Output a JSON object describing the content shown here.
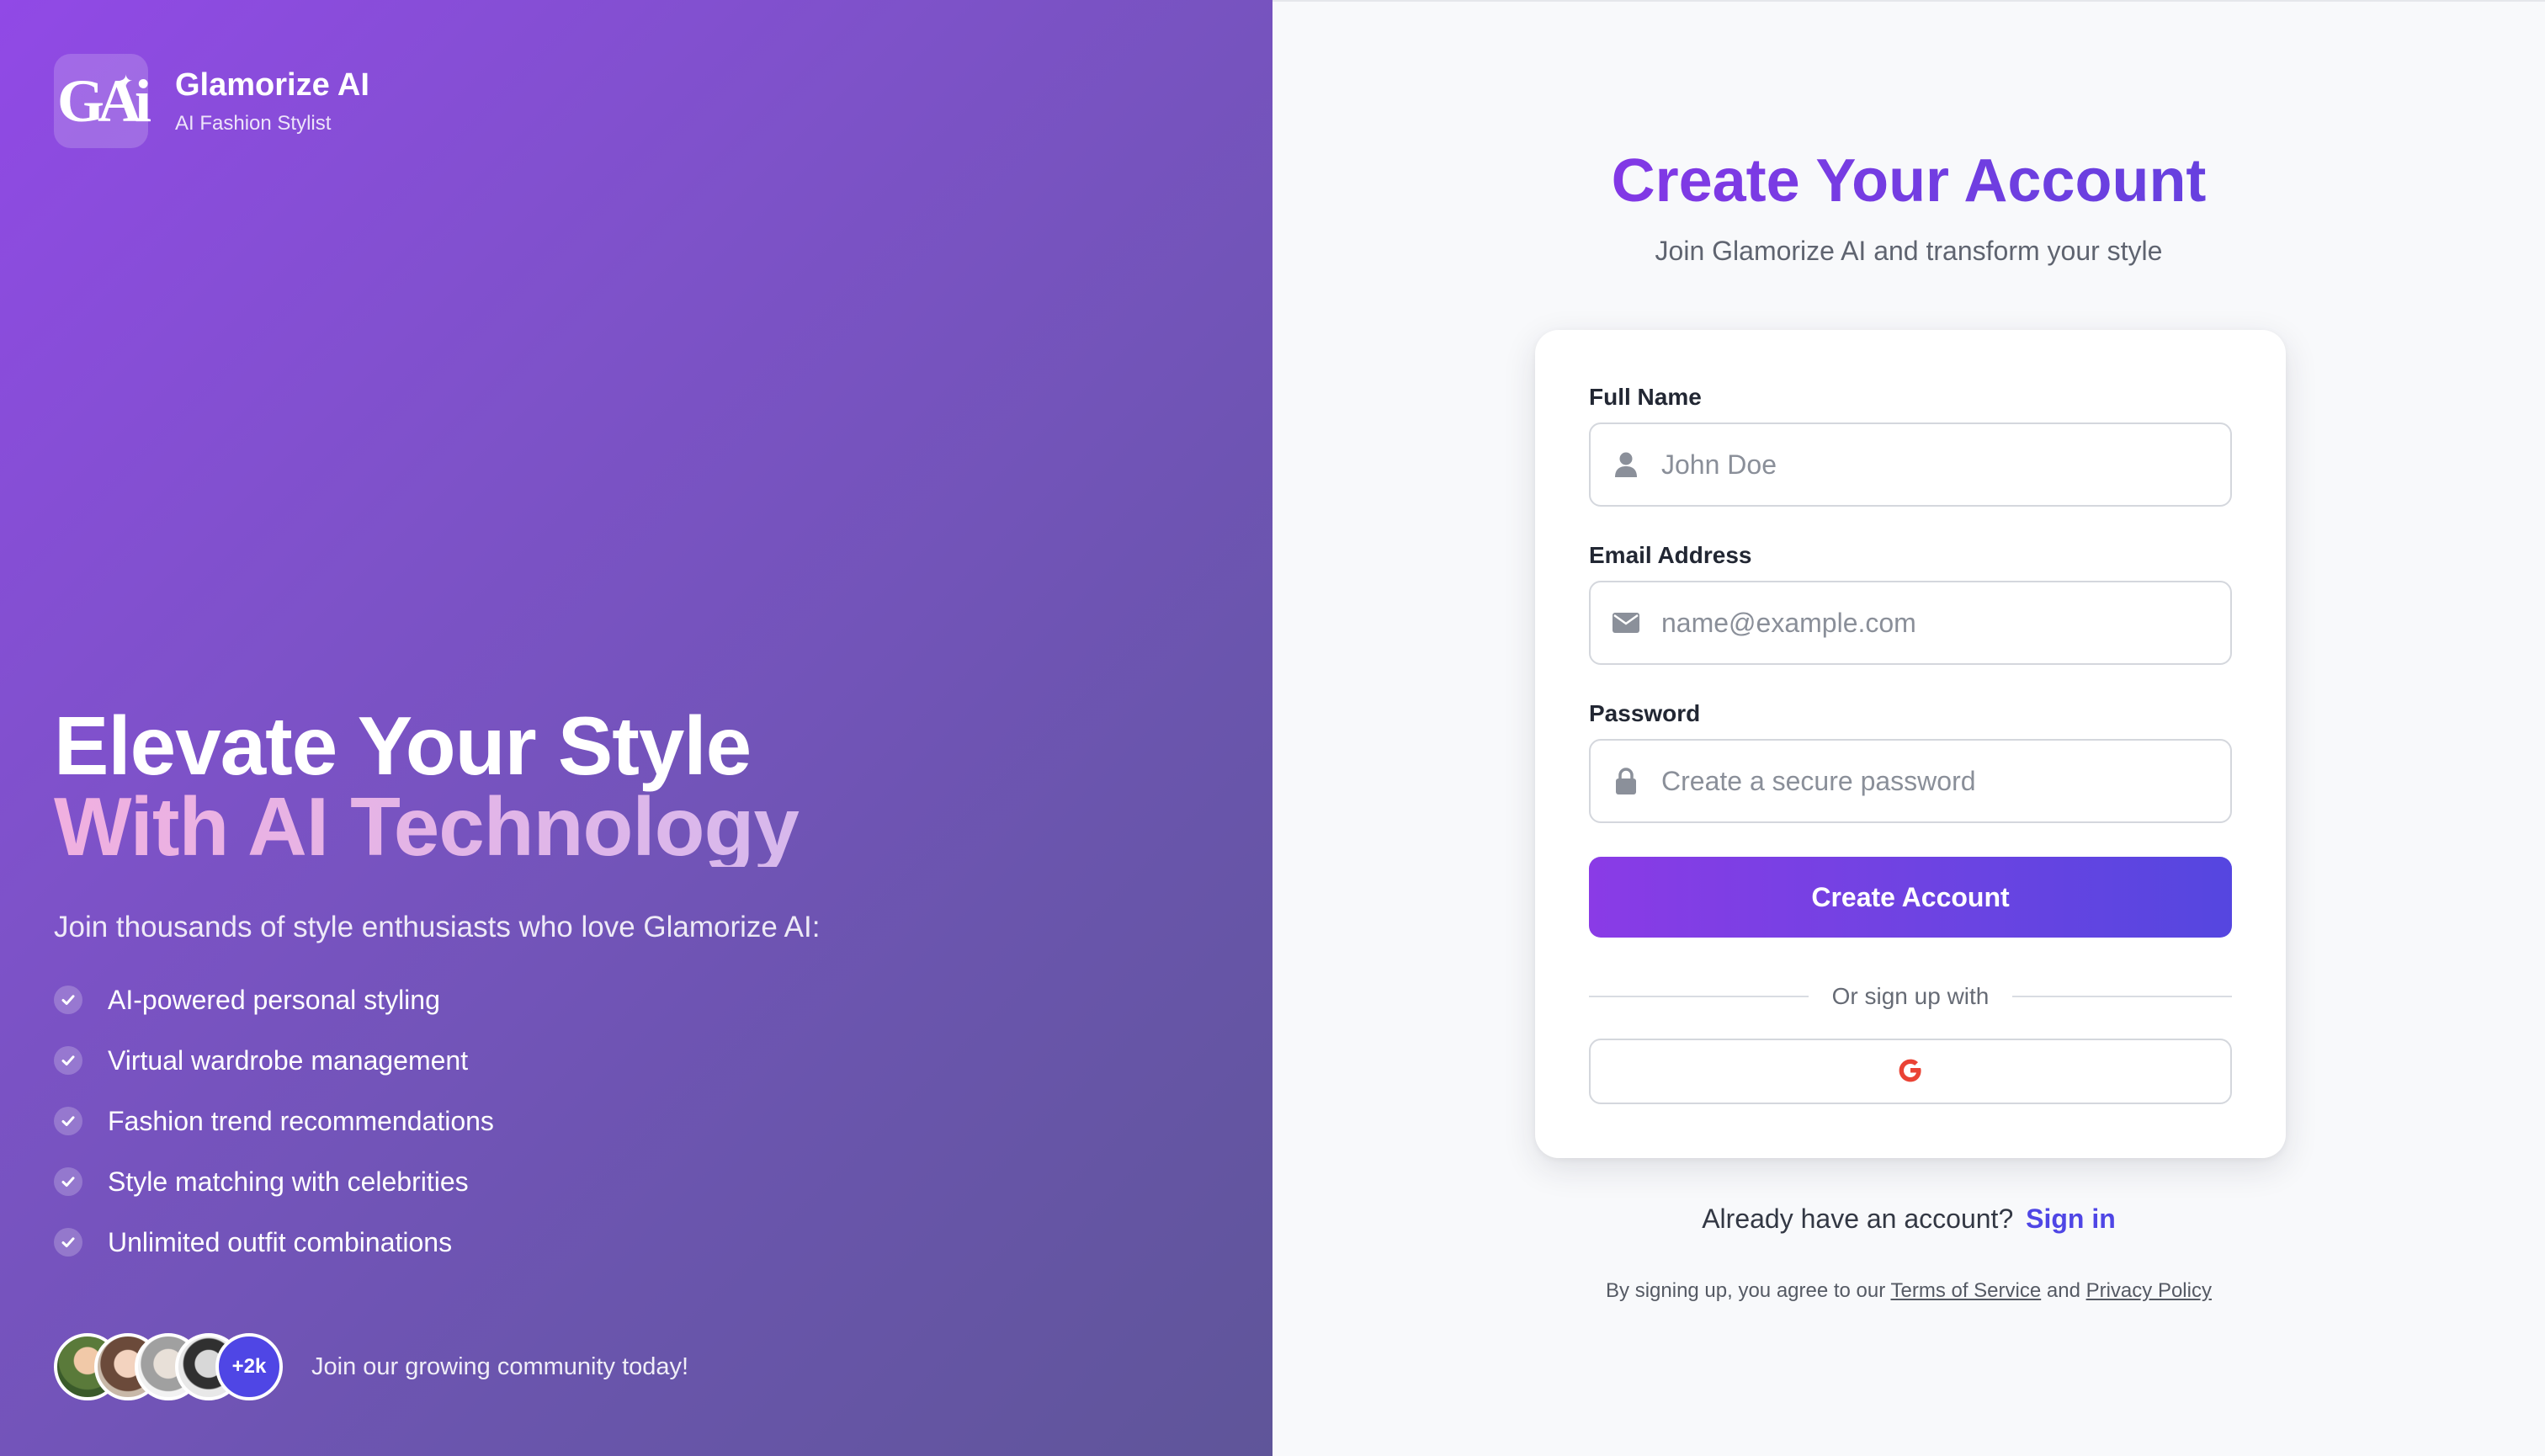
{
  "brand": {
    "logo_text": "GAi",
    "name": "Glamorize AI",
    "tagline": "AI Fashion Stylist"
  },
  "hero": {
    "line1": "Elevate Your Style",
    "line2": "With AI Technology",
    "subtitle": "Join thousands of style enthusiasts who love Glamorize AI:",
    "features": [
      "AI-powered personal styling",
      "Virtual wardrobe management",
      "Fashion trend recommendations",
      "Style matching with celebrities",
      "Unlimited outfit combinations"
    ]
  },
  "community": {
    "count_badge": "+2k",
    "text": "Join our growing community today!"
  },
  "form": {
    "title": "Create Your Account",
    "subtitle": "Join Glamorize AI and transform your style",
    "full_name": {
      "label": "Full Name",
      "placeholder": "John Doe",
      "value": ""
    },
    "email": {
      "label": "Email Address",
      "placeholder": "name@example.com",
      "value": ""
    },
    "password": {
      "label": "Password",
      "placeholder": "Create a secure password",
      "value": ""
    },
    "submit_label": "Create Account",
    "divider_text": "Or sign up with"
  },
  "signin": {
    "prompt": "Already have an account?",
    "link": "Sign in"
  },
  "terms": {
    "prefix": "By signing up, you agree to our",
    "tos": "Terms of Service",
    "and": "and",
    "privacy": "Privacy Policy"
  },
  "icons": {
    "check": "check-icon",
    "user": "user-icon",
    "mail": "envelope-icon",
    "lock": "lock-icon",
    "google": "google-icon"
  },
  "colors": {
    "accent": "#6d3fe0",
    "link": "#4f46e5",
    "google_red": "#ea4335"
  }
}
